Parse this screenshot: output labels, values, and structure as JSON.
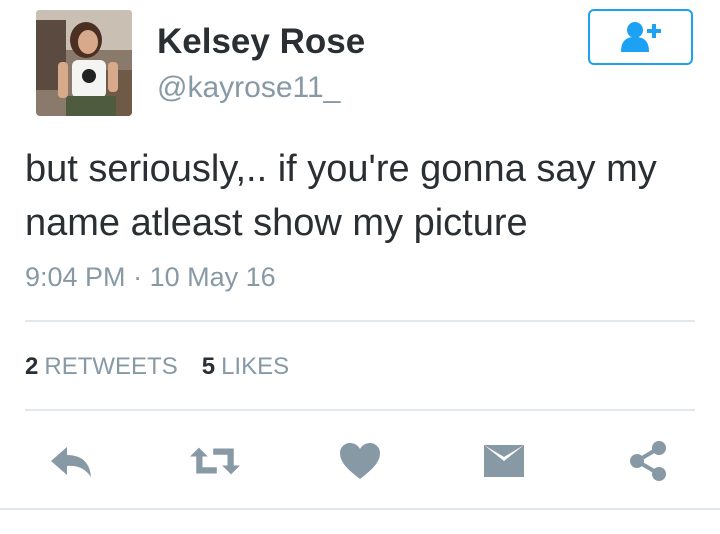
{
  "user": {
    "name": "Kelsey Rose",
    "handle": "@kayrose11_"
  },
  "tweet": {
    "text": "but seriously,.. if you're gonna say my name atleast show my picture",
    "time": "9:04 PM",
    "separator": "·",
    "date": "10 May 16"
  },
  "stats": {
    "retweets_count": "2",
    "retweets_label": "RETWEETS",
    "likes_count": "5",
    "likes_label": "LIKES"
  },
  "icons": {
    "follow": "add-user-icon",
    "reply": "reply-icon",
    "retweet": "retweet-icon",
    "like": "heart-icon",
    "dm": "envelope-icon",
    "share": "share-icon"
  },
  "colors": {
    "accent": "#1da1f2",
    "icon_gray": "#8899a6",
    "text": "#292f33",
    "divider": "#e1e8ed"
  }
}
